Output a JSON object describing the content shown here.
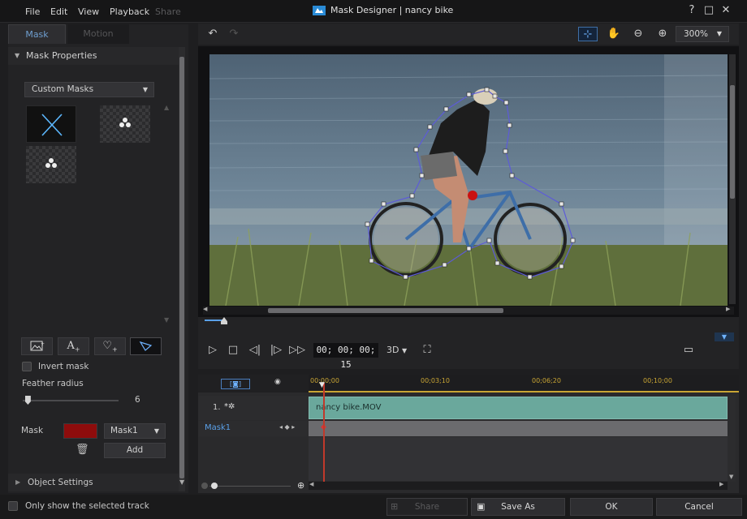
{
  "menu": {
    "items": [
      "File",
      "Edit",
      "View",
      "Playback",
      "Share"
    ]
  },
  "window": {
    "title": "Mask Designer  |  nancy bike",
    "help": "?",
    "restore": "□",
    "close": "✕",
    "minimize": "–"
  },
  "left": {
    "tabs": [
      "Mask",
      "Motion"
    ],
    "mask_properties": "Mask Properties",
    "custom_masks": "Custom Masks",
    "invert_mask": "Invert mask",
    "feather_radius_label": "Feather radius",
    "feather_radius_value": "6",
    "feather_radius_level": 0.05,
    "mask_label": "Mask",
    "mask_color": "#8e0c0c",
    "mask_selected": "Mask1",
    "add": "Add",
    "object_settings": "Object Settings"
  },
  "toolbar": {
    "zoom": "300%"
  },
  "playback": {
    "timecode": "00; 00; 00; 15",
    "mode": "3D"
  },
  "timeline": {
    "ruler": [
      "00;00;00",
      "00;03;10",
      "00;06;20",
      "00;10;00"
    ],
    "track1_label": "1.",
    "clip_name": "nancy bike.MOV",
    "mask_track": "Mask1"
  },
  "bottom": {
    "only_selected": "Only show the selected track",
    "share": "Share",
    "save_as": "Save As",
    "ok": "OK",
    "cancel": "Cancel"
  }
}
